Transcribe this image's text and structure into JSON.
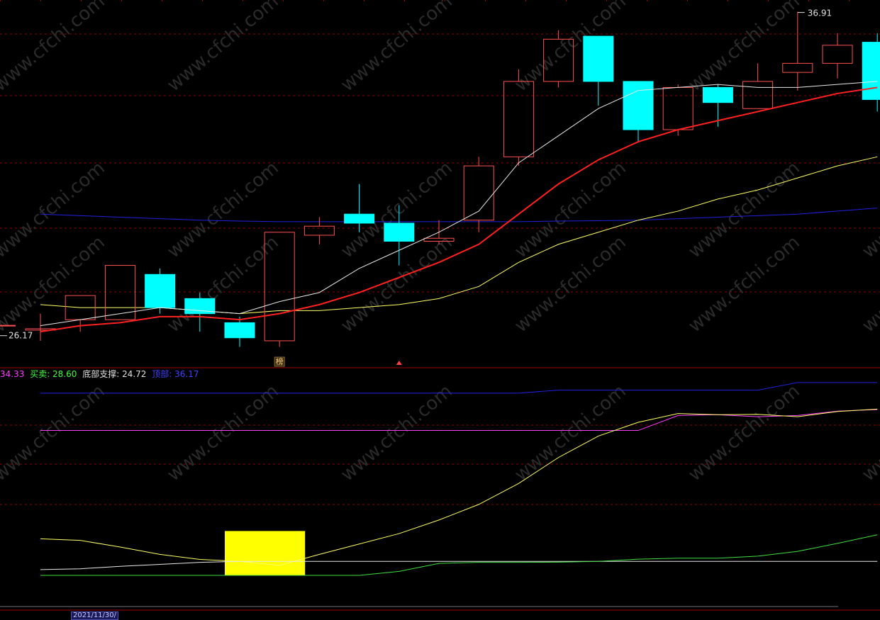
{
  "colors": {
    "bull": "#ff5050",
    "bear": "#00ffff",
    "ma_fast": "#e8e8e8",
    "ma_mid": "#ff2020",
    "ma_slow": "#ffff66",
    "ma_long": "#2020e0",
    "grid": "#8b0000",
    "legend_val1": "#ff40ff",
    "legend_buy": "#40ff40",
    "legend_bottom": "#e0e0e0",
    "legend_top": "#4040ff",
    "top_line": "#2020e0",
    "mid_line": "#ff40ff",
    "sup_line": "#ffff66",
    "white_line": "#e8e8e8",
    "green_line": "#40e040",
    "block": "#ffff00"
  },
  "chart_data": [
    {
      "type": "candlestick",
      "ylim": [
        25.2,
        37.3
      ],
      "candles": [
        {
          "o": 26.4,
          "h": 26.9,
          "l": 26.0,
          "c": 26.4
        },
        {
          "o": 26.7,
          "h": 27.5,
          "l": 26.3,
          "c": 27.5
        },
        {
          "o": 26.7,
          "h": 28.5,
          "l": 26.7,
          "c": 28.5
        },
        {
          "o": 28.2,
          "h": 28.4,
          "l": 26.9,
          "c": 27.1
        },
        {
          "o": 27.4,
          "h": 27.6,
          "l": 26.3,
          "c": 26.9
        },
        {
          "o": 26.6,
          "h": 26.8,
          "l": 25.8,
          "c": 26.1
        },
        {
          "o": 26.0,
          "h": 29.6,
          "l": 25.8,
          "c": 29.6
        },
        {
          "o": 29.5,
          "h": 30.1,
          "l": 29.2,
          "c": 29.8
        },
        {
          "o": 30.2,
          "h": 31.2,
          "l": 29.6,
          "c": 29.9
        },
        {
          "o": 29.9,
          "h": 30.5,
          "l": 28.5,
          "c": 29.3
        },
        {
          "o": 29.3,
          "h": 30.0,
          "l": 29.2,
          "c": 29.4
        },
        {
          "o": 30.0,
          "h": 32.1,
          "l": 29.6,
          "c": 31.8
        },
        {
          "o": 32.1,
          "h": 35.0,
          "l": 31.8,
          "c": 34.6
        },
        {
          "o": 34.6,
          "h": 36.3,
          "l": 34.4,
          "c": 36.0
        },
        {
          "o": 36.1,
          "h": 36.1,
          "l": 33.8,
          "c": 34.6
        },
        {
          "o": 34.6,
          "h": 34.6,
          "l": 32.6,
          "c": 33.0
        },
        {
          "o": 33.0,
          "h": 34.5,
          "l": 32.8,
          "c": 34.4
        },
        {
          "o": 34.4,
          "h": 34.5,
          "l": 33.1,
          "c": 33.9
        },
        {
          "o": 33.7,
          "h": 35.2,
          "l": 33.7,
          "c": 34.6
        },
        {
          "o": 34.9,
          "h": 36.91,
          "l": 34.3,
          "c": 35.2
        },
        {
          "o": 35.2,
          "h": 36.2,
          "l": 34.7,
          "c": 35.8
        },
        {
          "o": 35.9,
          "h": 36.2,
          "l": 33.6,
          "c": 34.0
        }
      ],
      "series": [
        {
          "values": [
            26.5,
            26.7,
            26.9,
            27.1,
            27.0,
            26.9,
            27.3,
            27.6,
            28.4,
            29.0,
            29.6,
            30.3,
            31.9,
            32.8,
            33.7,
            34.3,
            34.4,
            34.5,
            34.4,
            34.4,
            34.5,
            34.6
          ]
        },
        {
          "values": [
            26.3,
            26.5,
            26.6,
            26.8,
            26.8,
            26.7,
            26.9,
            27.2,
            27.6,
            28.1,
            28.6,
            29.2,
            30.2,
            31.2,
            32.0,
            32.6,
            33.0,
            33.3,
            33.6,
            33.9,
            34.2,
            34.4
          ]
        },
        {
          "values": [
            27.2,
            27.1,
            27.1,
            27.1,
            27.0,
            26.9,
            27.0,
            27.0,
            27.1,
            27.2,
            27.4,
            27.8,
            28.6,
            29.2,
            29.6,
            30.0,
            30.3,
            30.7,
            31.0,
            31.4,
            31.8,
            32.1
          ]
        },
        {
          "values": [
            30.2,
            30.15,
            30.1,
            30.05,
            30.0,
            29.97,
            29.95,
            29.95,
            29.95,
            29.95,
            29.95,
            29.95,
            29.95,
            29.97,
            29.98,
            30.0,
            30.05,
            30.1,
            30.15,
            30.2,
            30.3,
            30.4
          ]
        }
      ],
      "annotations": [
        {
          "text": "36.91",
          "candle": 19,
          "value": 36.91
        },
        {
          "text": "26.17",
          "value": 26.17
        },
        {
          "text": "榜",
          "candle": 6
        }
      ]
    },
    {
      "type": "line",
      "ylim": [
        0,
        100
      ],
      "series": [
        {
          "values": [
            91.2,
            91.2,
            91.2,
            91.2,
            91.2,
            91.2,
            91.2,
            91.2,
            91.2,
            91.2,
            91.2,
            91.2,
            91.2,
            92.7,
            92.7,
            92.7,
            92.7,
            92.7,
            92.7,
            96.5,
            96.5,
            96.5
          ]
        },
        {
          "values": [
            72.5,
            72.5,
            72.5,
            72.5,
            72.5,
            72.5,
            72.5,
            72.5,
            72.5,
            72.5,
            72.5,
            72.5,
            72.5,
            72.5,
            72.5,
            72.5,
            80.0,
            80.4,
            79.4,
            80.0,
            82.2,
            83.0
          ]
        },
        {
          "values": [
            18.3,
            17.5,
            14.2,
            10.5,
            8.0,
            7.0,
            5.0,
            10.5,
            15.7,
            20.9,
            27.7,
            35.5,
            46.0,
            59.0,
            69.7,
            76.6,
            81.0,
            80.4,
            80.6,
            79.4,
            82.0,
            83.2
          ]
        },
        {
          "values": [
            2.9,
            3.3,
            4.5,
            5.5,
            6.5,
            7.0,
            7.0,
            7.0,
            7.0,
            7.0,
            7.0,
            7.0,
            7.0,
            7.0,
            7.0,
            7.0,
            7.0,
            7.0,
            7.0,
            7.0,
            7.0,
            7.0
          ]
        },
        {
          "values": [
            0,
            0,
            0,
            0,
            0,
            0,
            0,
            0,
            0,
            2.0,
            6.0,
            6.5,
            6.5,
            6.6,
            7.0,
            8.1,
            8.6,
            8.6,
            9.6,
            12.0,
            16.0,
            20.3
          ]
        }
      ],
      "block": {
        "from_candle": 5,
        "to_candle": 6,
        "value_range": [
          0,
          22.2
        ]
      }
    }
  ],
  "legend": {
    "val1": "34.33",
    "buy_label": "买卖: 28.60",
    "bottom_label": "底部支撑: 24.72",
    "top_label": "顶部: 36.17"
  },
  "annotations": {
    "high_label": "36.91",
    "low_label": "26.17",
    "marker_char": "榜"
  },
  "watermark": "www.cfchi.com",
  "date_tag": "2021/11/30/"
}
